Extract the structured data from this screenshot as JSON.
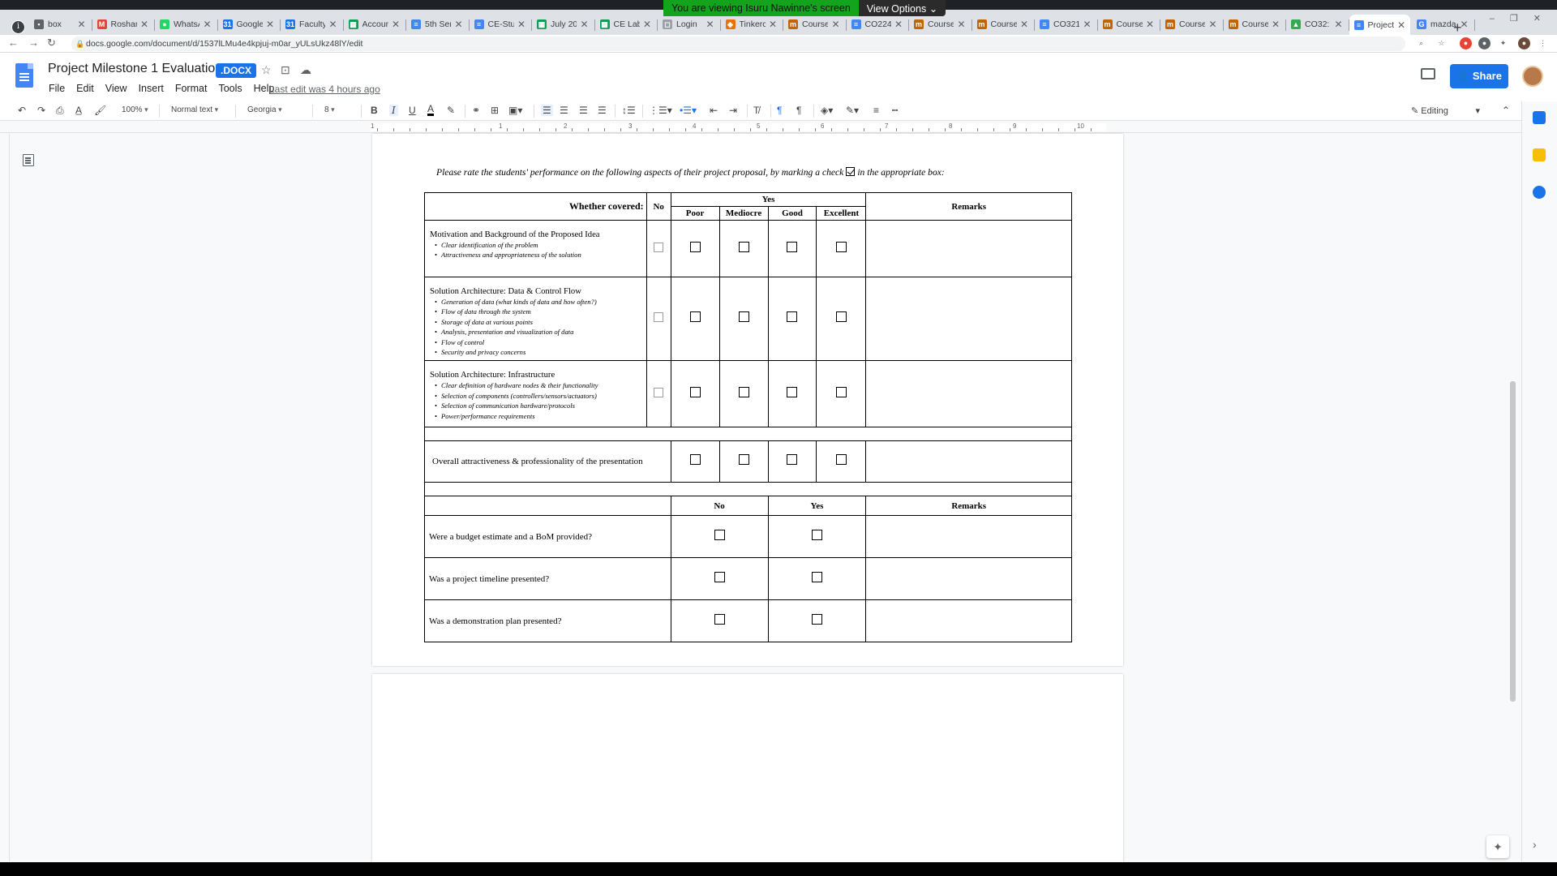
{
  "browser": {
    "tabs": [
      {
        "label": "box",
        "color": "#5f6368",
        "glyph": "▪"
      },
      {
        "label": "Roshan",
        "color": "#ea4335",
        "glyph": "M"
      },
      {
        "label": "WhatsA",
        "color": "#25d366",
        "glyph": "●"
      },
      {
        "label": "Google",
        "color": "#1a73e8",
        "glyph": "31"
      },
      {
        "label": "Faculty",
        "color": "#1a73e8",
        "glyph": "31"
      },
      {
        "label": "Accoun",
        "color": "#0f9d58",
        "glyph": "▦"
      },
      {
        "label": "5th Ser",
        "color": "#4285f4",
        "glyph": "≡"
      },
      {
        "label": "CE-Stu",
        "color": "#4285f4",
        "glyph": "≡"
      },
      {
        "label": "July 20",
        "color": "#0f9d58",
        "glyph": "▦"
      },
      {
        "label": "CE Lab",
        "color": "#0f9d58",
        "glyph": "▦"
      },
      {
        "label": "Login",
        "color": "#9aa0a6",
        "glyph": "◻"
      },
      {
        "label": "Tinkerc",
        "color": "#e8710a",
        "glyph": "◆"
      },
      {
        "label": "Course",
        "color": "#c26401",
        "glyph": "m"
      },
      {
        "label": "CO224",
        "color": "#4285f4",
        "glyph": "≡"
      },
      {
        "label": "Course",
        "color": "#c26401",
        "glyph": "m"
      },
      {
        "label": "Course",
        "color": "#c26401",
        "glyph": "m"
      },
      {
        "label": "CO321",
        "color": "#4285f4",
        "glyph": "≡"
      },
      {
        "label": "Course",
        "color": "#c26401",
        "glyph": "m"
      },
      {
        "label": "Course",
        "color": "#c26401",
        "glyph": "m"
      },
      {
        "label": "Course",
        "color": "#c26401",
        "glyph": "m"
      },
      {
        "label": "CO32:",
        "color": "#34a853",
        "glyph": "▲"
      },
      {
        "label": "Project",
        "color": "#4285f4",
        "glyph": "≡",
        "active": true
      },
      {
        "label": "mazda",
        "color": "#4285f4",
        "glyph": "G"
      }
    ],
    "url": "docs.google.com/document/d/1537lLMu4e4kpjuj-m0ar_yULsUkz48lY/edit",
    "screen_share_banner": "You are viewing Isuru Nawinne's screen",
    "view_options_label": "View Options"
  },
  "docs": {
    "title": "Project Milestone 1 Evaluation",
    "badge": ".DOCX",
    "menu": [
      "File",
      "Edit",
      "View",
      "Insert",
      "Format",
      "Tools",
      "Help"
    ],
    "last_edit": "Last edit was 4 hours ago",
    "share_label": "Share"
  },
  "toolbar": {
    "zoom": "100%",
    "style": "Normal text",
    "font": "Georgia",
    "size": "8",
    "mode": "Editing"
  },
  "ruler_numbers": [
    "1",
    "1",
    "2",
    "3",
    "4",
    "5",
    "6",
    "7",
    "8",
    "9",
    "10"
  ],
  "document": {
    "instruction_before": "Please rate the students' performance on the following aspects of their project proposal, by marking a check",
    "instruction_after": "in the appropriate box:",
    "table1": {
      "whether_covered": "Whether covered:",
      "no": "No",
      "yes": "Yes",
      "ratings": [
        "Poor",
        "Mediocre",
        "Good",
        "Excellent"
      ],
      "remarks": "Remarks",
      "criteria": [
        {
          "title": "Motivation and Background of the Proposed Idea",
          "bullets": [
            "Clear identification of the problem",
            "Attractiveness and appropriateness of the solution"
          ]
        },
        {
          "title": "Solution Architecture: Data & Control Flow",
          "bullets": [
            "Generation of data (what kinds of data and how often?)",
            "Flow of data through the system",
            "Storage of data at various points",
            "Analysis, presentation and visualization of data",
            "Flow of control",
            "Security and privacy concerns"
          ]
        },
        {
          "title": "Solution Architecture: Infrastructure",
          "bullets": [
            "Clear definition of hardware nodes & their functionality",
            "Selection of components (controllers/sensors/actuators)",
            "Selection of communication hardware/protocols",
            "Power/performance requirements"
          ]
        }
      ],
      "overall": "Overall attractiveness & professionality of the presentation"
    },
    "table2": {
      "no": "No",
      "yes": "Yes",
      "remarks": "Remarks",
      "questions": [
        "Were a budget estimate and a BoM provided?",
        "Was a project timeline presented?",
        "Was a demonstration plan presented?"
      ]
    }
  }
}
